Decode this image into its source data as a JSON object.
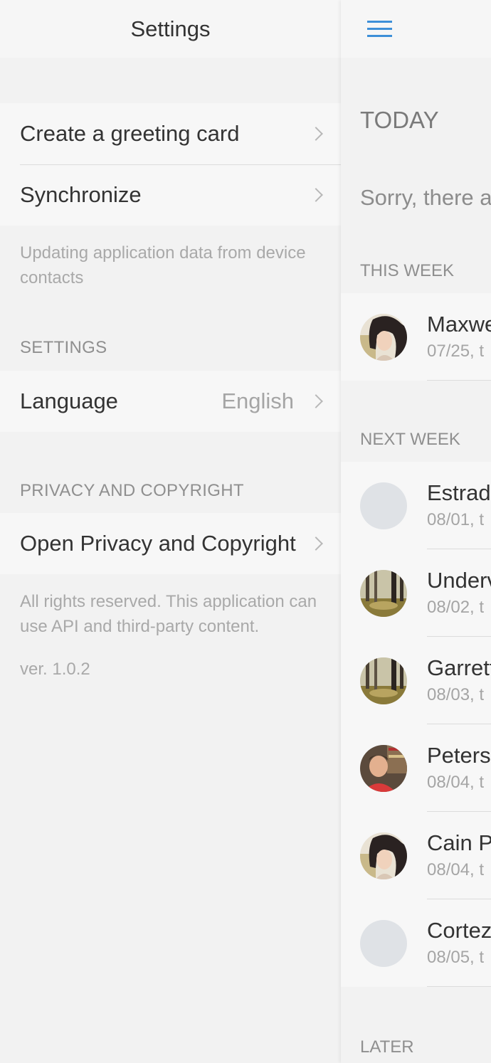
{
  "settings_panel": {
    "title": "Settings",
    "items_top": [
      {
        "label": "Create a greeting card"
      },
      {
        "label": "Synchronize"
      }
    ],
    "sync_note": "Updating application data from device contacts",
    "settings_section": "SETTINGS",
    "language": {
      "label": "Language",
      "value": "English"
    },
    "privacy_section": "PRIVACY AND COPYRIGHT",
    "privacy_item": {
      "label": "Open Privacy and Copyright"
    },
    "rights_note": "All rights reserved. This application can use API and third-party content.",
    "version": "ver. 1.0.2"
  },
  "main_panel": {
    "menu_icon": "hamburger-menu-icon",
    "accent_color": "#3d8fd8",
    "today_label": "TODAY",
    "empty_message": "Sorry, there ar",
    "this_week_label": "THIS WEEK",
    "this_week": [
      {
        "name": "Maxwe",
        "date": "07/25, t",
        "avatar": "photo-woman"
      }
    ],
    "next_week_label": "NEXT WEEK",
    "next_week": [
      {
        "name": "Estrad",
        "date": "08/01, t",
        "avatar": "placeholder"
      },
      {
        "name": "Underv",
        "date": "08/02, t",
        "avatar": "photo-forest"
      },
      {
        "name": "Garrett",
        "date": "08/03, t",
        "avatar": "photo-forest"
      },
      {
        "name": "Peterso",
        "date": "08/04, t",
        "avatar": "photo-man"
      },
      {
        "name": "Cain P",
        "date": "08/04, t",
        "avatar": "photo-woman"
      },
      {
        "name": "Cortez",
        "date": "08/05, t",
        "avatar": "placeholder"
      }
    ],
    "later_label": "LATER"
  }
}
